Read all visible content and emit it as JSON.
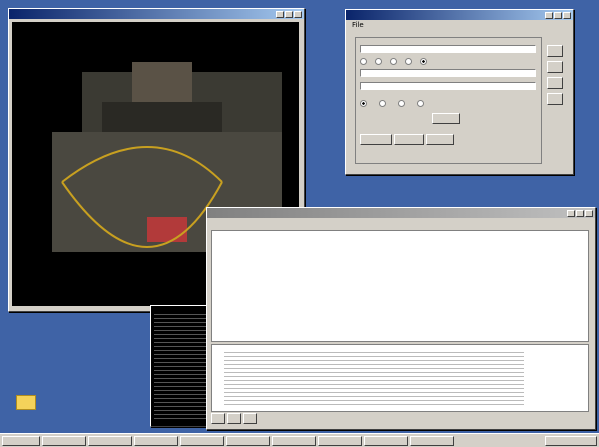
{
  "desktop": {
    "icon_label": ""
  },
  "map_window": {
    "title": ""
  },
  "agent_window": {
    "title": "",
    "menu": [
      "File"
    ],
    "buttons": [
      "",
      "",
      "",
      "",
      ""
    ],
    "tabs": [
      "",
      "",
      ""
    ]
  },
  "log_window": {
    "title": "",
    "menu": [
      "",
      "",
      "",
      "",
      "",
      "",
      "",
      ""
    ],
    "menu_right": [
      "",
      ""
    ],
    "rows": 10,
    "footer_buttons": [
      "",
      "",
      ""
    ]
  },
  "console_window": {},
  "taskbar": {
    "start": "",
    "clock": ""
  }
}
